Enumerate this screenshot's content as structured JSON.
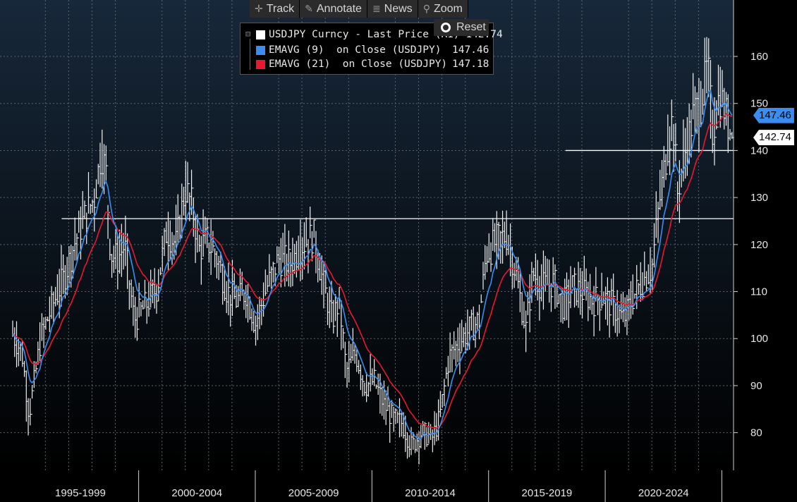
{
  "toolbar": {
    "track": "Track",
    "annotate": "Annotate",
    "news": "News",
    "zoom": "Zoom",
    "reset": "Reset"
  },
  "legend": {
    "items": [
      {
        "label": "USDJPY Curncy - Last Price (R1) 142.74",
        "value": "",
        "color": "#ffffff"
      },
      {
        "label": "EMAVG (9)  on Close (USDJPY)",
        "value": "147.46",
        "color": "#3b8ef0"
      },
      {
        "label": "EMAVG (21)  on Close (USDJPY)",
        "value": "147.18",
        "color": "#e8182d"
      }
    ]
  },
  "tags": {
    "ema9": {
      "text": "147.46",
      "color": "#3b8ef0",
      "value": 147.46
    },
    "last": {
      "text": "142.74",
      "color": "#ffffff",
      "value": 142.74
    }
  },
  "chart_data": {
    "type": "line",
    "title": "",
    "xlabel": "",
    "ylabel": "",
    "x_range": [
      1994.6,
      2025.5
    ],
    "ylim": [
      72,
      172
    ],
    "y_ticks": [
      80,
      90,
      100,
      110,
      120,
      130,
      140,
      150,
      160
    ],
    "x_periods": [
      {
        "label": "1995-1999",
        "start": 1995,
        "end": 2000
      },
      {
        "label": "2000-2004",
        "start": 2000,
        "end": 2005
      },
      {
        "label": "2005-2009",
        "start": 2005,
        "end": 2010
      },
      {
        "label": "2010-2014",
        "start": 2010,
        "end": 2015
      },
      {
        "label": "2015-2019",
        "start": 2015,
        "end": 2020
      },
      {
        "label": "2020-2024",
        "start": 2020,
        "end": 2025
      }
    ],
    "vertical_gridlines": [
      1996,
      1997,
      1998,
      1999,
      2001,
      2002,
      2003,
      2004,
      2006,
      2007,
      2008,
      2009,
      2011,
      2012,
      2013,
      2014,
      2016,
      2017,
      2018,
      2019,
      2021,
      2022,
      2023,
      2024
    ],
    "horizontal_lines": [
      {
        "y": 125.5,
        "x_start": 1996.7,
        "x_end": 2025.5
      },
      {
        "y": 140.0,
        "x_start": 2018.3,
        "x_end": 2025.5
      }
    ],
    "grid": true,
    "price_anchors": [
      {
        "x": 1994.6,
        "y": 101
      },
      {
        "x": 1995.0,
        "y": 97
      },
      {
        "x": 1995.3,
        "y": 84
      },
      {
        "x": 1995.5,
        "y": 90
      },
      {
        "x": 1995.8,
        "y": 100
      },
      {
        "x": 1996.3,
        "y": 107
      },
      {
        "x": 1996.8,
        "y": 113
      },
      {
        "x": 1997.3,
        "y": 121
      },
      {
        "x": 1997.7,
        "y": 126
      },
      {
        "x": 1998.1,
        "y": 130
      },
      {
        "x": 1998.4,
        "y": 140
      },
      {
        "x": 1998.6,
        "y": 135
      },
      {
        "x": 1998.8,
        "y": 118
      },
      {
        "x": 1999.1,
        "y": 117
      },
      {
        "x": 1999.4,
        "y": 120
      },
      {
        "x": 1999.8,
        "y": 104
      },
      {
        "x": 2000.3,
        "y": 107
      },
      {
        "x": 2000.8,
        "y": 111
      },
      {
        "x": 2001.2,
        "y": 123
      },
      {
        "x": 2001.6,
        "y": 120
      },
      {
        "x": 2002.0,
        "y": 132
      },
      {
        "x": 2002.3,
        "y": 128
      },
      {
        "x": 2002.6,
        "y": 119
      },
      {
        "x": 2002.9,
        "y": 121
      },
      {
        "x": 2003.3,
        "y": 118
      },
      {
        "x": 2003.8,
        "y": 110
      },
      {
        "x": 2004.2,
        "y": 108
      },
      {
        "x": 2004.6,
        "y": 110
      },
      {
        "x": 2005.0,
        "y": 103
      },
      {
        "x": 2005.5,
        "y": 111
      },
      {
        "x": 2006.0,
        "y": 117
      },
      {
        "x": 2006.5,
        "y": 116
      },
      {
        "x": 2007.0,
        "y": 120
      },
      {
        "x": 2007.5,
        "y": 122
      },
      {
        "x": 2007.9,
        "y": 112
      },
      {
        "x": 2008.3,
        "y": 104
      },
      {
        "x": 2008.6,
        "y": 108
      },
      {
        "x": 2008.9,
        "y": 93
      },
      {
        "x": 2009.3,
        "y": 97
      },
      {
        "x": 2009.7,
        "y": 90
      },
      {
        "x": 2010.1,
        "y": 91
      },
      {
        "x": 2010.5,
        "y": 86
      },
      {
        "x": 2010.9,
        "y": 83
      },
      {
        "x": 2011.3,
        "y": 82
      },
      {
        "x": 2011.7,
        "y": 77
      },
      {
        "x": 2012.1,
        "y": 80
      },
      {
        "x": 2012.6,
        "y": 79
      },
      {
        "x": 2012.9,
        "y": 83
      },
      {
        "x": 2013.3,
        "y": 96
      },
      {
        "x": 2013.7,
        "y": 99
      },
      {
        "x": 2014.2,
        "y": 102
      },
      {
        "x": 2014.6,
        "y": 104
      },
      {
        "x": 2014.9,
        "y": 118
      },
      {
        "x": 2015.4,
        "y": 121
      },
      {
        "x": 2015.8,
        "y": 122
      },
      {
        "x": 2016.2,
        "y": 113
      },
      {
        "x": 2016.6,
        "y": 102
      },
      {
        "x": 2016.9,
        "y": 114
      },
      {
        "x": 2017.3,
        "y": 111
      },
      {
        "x": 2017.8,
        "y": 112
      },
      {
        "x": 2018.2,
        "y": 107
      },
      {
        "x": 2018.6,
        "y": 111
      },
      {
        "x": 2019.0,
        "y": 110
      },
      {
        "x": 2019.5,
        "y": 108
      },
      {
        "x": 2019.9,
        "y": 109
      },
      {
        "x": 2020.3,
        "y": 107
      },
      {
        "x": 2020.8,
        "y": 104
      },
      {
        "x": 2021.2,
        "y": 109
      },
      {
        "x": 2021.7,
        "y": 113
      },
      {
        "x": 2022.0,
        "y": 115
      },
      {
        "x": 2022.3,
        "y": 128
      },
      {
        "x": 2022.7,
        "y": 142
      },
      {
        "x": 2022.9,
        "y": 147
      },
      {
        "x": 2023.1,
        "y": 131
      },
      {
        "x": 2023.4,
        "y": 139
      },
      {
        "x": 2023.8,
        "y": 148
      },
      {
        "x": 2024.1,
        "y": 150
      },
      {
        "x": 2024.4,
        "y": 158
      },
      {
        "x": 2024.6,
        "y": 144
      },
      {
        "x": 2024.9,
        "y": 152
      },
      {
        "x": 2025.1,
        "y": 149
      },
      {
        "x": 2025.3,
        "y": 145
      },
      {
        "x": 2025.5,
        "y": 143
      }
    ],
    "series": [
      {
        "name": "USDJPY Curncy - Last Price (R1)",
        "role": "price bars",
        "color": "#ffffff",
        "last": 142.74
      },
      {
        "name": "EMAVG (9)  on Close (USDJPY)",
        "period": 9,
        "color": "#3b8ef0",
        "last": 147.46
      },
      {
        "name": "EMAVG (21)  on Close (USDJPY)",
        "period": 21,
        "color": "#e8182d",
        "last": 147.18
      }
    ]
  }
}
